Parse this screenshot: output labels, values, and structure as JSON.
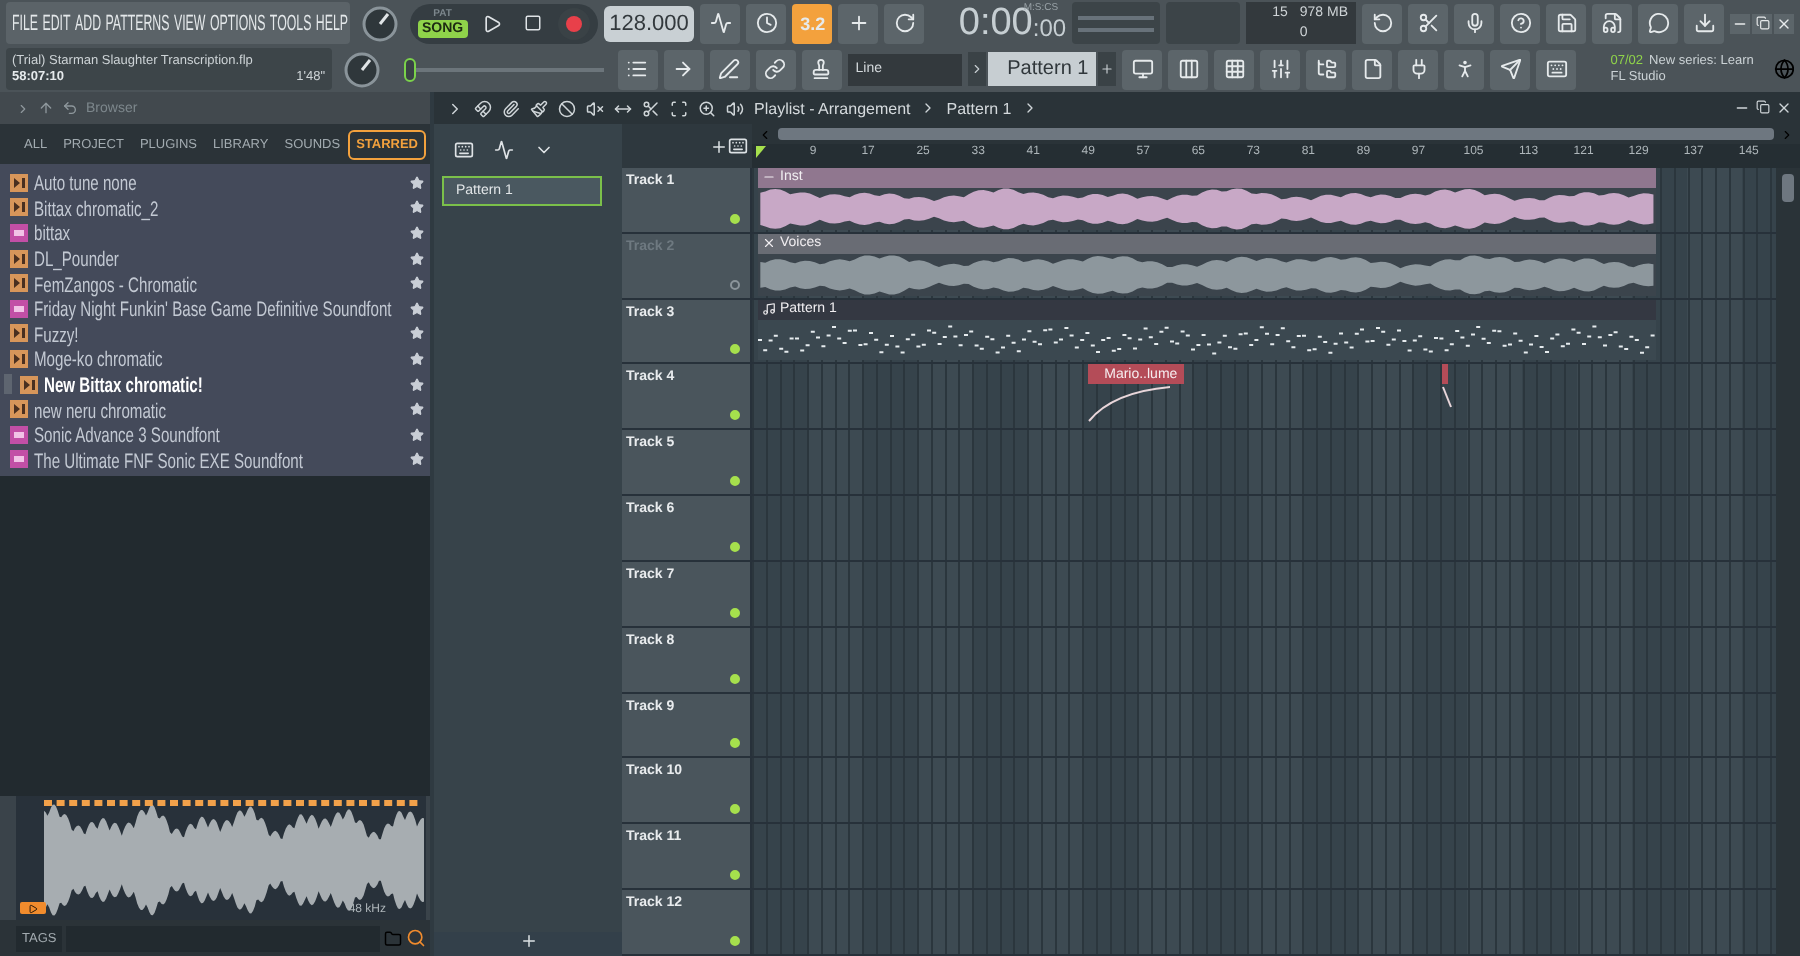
{
  "menu": [
    "FILE",
    "EDIT",
    "ADD",
    "PATTERNS",
    "VIEW",
    "OPTIONS",
    "TOOLS",
    "HELP"
  ],
  "project": {
    "title": "(Trial) Starman Slaughter Transcription.flp",
    "time": "58:07:10",
    "length": "1'48\""
  },
  "master_volume": {
    "level": 0
  },
  "transport": {
    "modes": [
      {
        "label": "PAT",
        "selected": false
      },
      {
        "label": "SONG",
        "selected": true
      }
    ],
    "tempo": "128.000"
  },
  "countdown": {
    "label": "3.2",
    "on": true
  },
  "clock": {
    "unit": "M:S:CS",
    "time": "0:00",
    "sub": ":00"
  },
  "monitor": {
    "cpu": "15",
    "memory": "978 MB",
    "polyphony": "0"
  },
  "snap": "Line",
  "pattern": "Pattern 1",
  "news": {
    "date": "07/02",
    "text": "New series: Learn FL Studio"
  },
  "browser": {
    "title": "Browser",
    "tabs": [
      {
        "label": "ALL",
        "selected": false
      },
      {
        "label": "PROJECT",
        "selected": false
      },
      {
        "label": "PLUGINS",
        "selected": false
      },
      {
        "label": "LIBRARY",
        "selected": false
      },
      {
        "label": "SOUNDS",
        "selected": false
      },
      {
        "label": "STARRED",
        "selected": true
      }
    ],
    "items": [
      {
        "name": "Auto tune none",
        "kind": "preset",
        "starred": true,
        "selected": false
      },
      {
        "name": "Bittax chromatic_2",
        "kind": "preset",
        "starred": true,
        "selected": false
      },
      {
        "name": "bittax",
        "kind": "soundfont",
        "starred": true,
        "selected": false
      },
      {
        "name": "DL_Pounder",
        "kind": "preset",
        "starred": true,
        "selected": false
      },
      {
        "name": "FemZangos - Chromatic",
        "kind": "preset",
        "starred": true,
        "selected": false
      },
      {
        "name": "Friday Night Funkin' Base Game Definitive Soundfont",
        "kind": "soundfont",
        "starred": true,
        "selected": false
      },
      {
        "name": "Fuzzy!",
        "kind": "preset",
        "starred": true,
        "selected": false
      },
      {
        "name": "Moge-ko chromatic",
        "kind": "preset",
        "starred": true,
        "selected": false
      },
      {
        "name": "New Bittax chromatic!",
        "kind": "preset",
        "starred": true,
        "selected": true
      },
      {
        "name": "new neru chromatic",
        "kind": "preset",
        "starred": true,
        "selected": false
      },
      {
        "name": "Sonic Advance 3 Soundfont",
        "kind": "soundfont",
        "starred": true,
        "selected": false
      },
      {
        "name": "The Ultimate FNF Sonic EXE Soundfont",
        "kind": "soundfont",
        "starred": true,
        "selected": false
      }
    ],
    "preview": {
      "rate": "48 kHz"
    },
    "tags_label": "TAGS"
  },
  "playlist": {
    "title": "Playlist - Arrangement",
    "pattern": "Pattern 1",
    "patterns": [
      {
        "name": "Pattern 1",
        "selected": true
      }
    ],
    "ruler": [
      "9",
      "17",
      "25",
      "33",
      "41",
      "49",
      "57",
      "65",
      "73",
      "81",
      "89",
      "97",
      "105",
      "113",
      "121",
      "129",
      "137",
      "145"
    ],
    "tracks": [
      {
        "name": "Track 1",
        "muted": false,
        "clips": [
          {
            "kind": "audio",
            "label": "Inst",
            "color": "#c8a8c6"
          }
        ]
      },
      {
        "name": "Track 2",
        "muted": true,
        "clips": [
          {
            "kind": "audio",
            "label": "Voices",
            "color": "#8d979d"
          }
        ]
      },
      {
        "name": "Track 3",
        "muted": false,
        "clips": [
          {
            "kind": "pattern",
            "label": "Pattern 1",
            "color": "#3b4850"
          }
        ]
      },
      {
        "name": "Track 4",
        "muted": false,
        "clips": [
          {
            "kind": "automation",
            "label": "Mario..lume",
            "color": "#b44c58"
          },
          {
            "kind": "automation",
            "color": "#b44c58"
          }
        ]
      },
      {
        "name": "Track 5",
        "muted": false
      },
      {
        "name": "Track 6",
        "muted": false
      },
      {
        "name": "Track 7",
        "muted": false
      },
      {
        "name": "Track 8",
        "muted": false
      },
      {
        "name": "Track 9",
        "muted": false
      },
      {
        "name": "Track 10",
        "muted": false
      },
      {
        "name": "Track 11",
        "muted": false
      },
      {
        "name": "Track 12",
        "muted": false
      }
    ]
  }
}
